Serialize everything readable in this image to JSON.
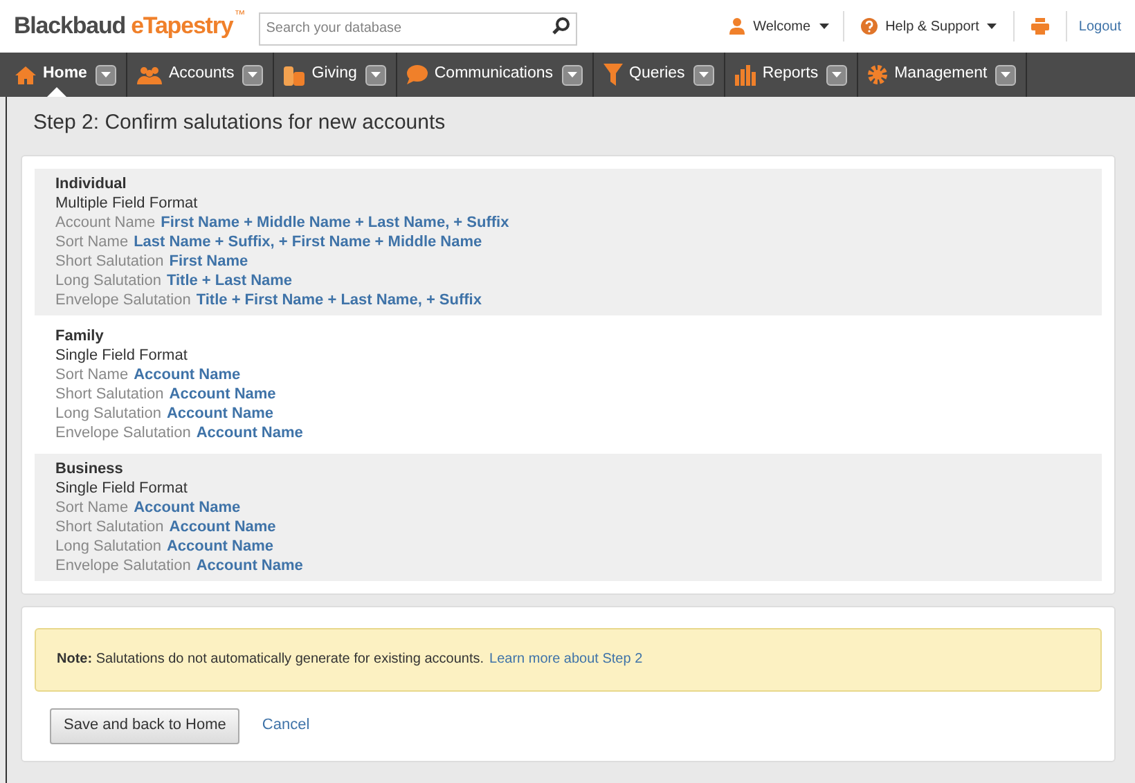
{
  "header": {
    "logo_main": "Blackbaud",
    "logo_accent": "eTapestry",
    "logo_mark": "™",
    "search": {
      "placeholder": "Search your database"
    },
    "welcome": "Welcome",
    "help": "Help & Support",
    "logout": "Logout"
  },
  "nav": [
    {
      "label": "Home",
      "selected": true
    },
    {
      "label": "Accounts",
      "selected": false
    },
    {
      "label": "Giving",
      "selected": false
    },
    {
      "label": "Communications",
      "selected": false
    },
    {
      "label": "Queries",
      "selected": false
    },
    {
      "label": "Reports",
      "selected": false
    },
    {
      "label": "Management",
      "selected": false
    }
  ],
  "page_title": "Step 2: Confirm salutations for new accounts",
  "sections": [
    {
      "title": "Individual",
      "format": "Multiple Field Format",
      "fields": [
        {
          "label": "Account Name",
          "value": "First Name + Middle Name + Last Name, + Suffix"
        },
        {
          "label": "Sort Name",
          "value": "Last Name + Suffix, + First Name + Middle Name"
        },
        {
          "label": "Short Salutation",
          "value": "First Name"
        },
        {
          "label": "Long Salutation",
          "value": "Title + Last Name"
        },
        {
          "label": "Envelope Salutation",
          "value": "Title + First Name + Last Name, + Suffix"
        }
      ]
    },
    {
      "title": "Family",
      "format": "Single Field Format",
      "fields": [
        {
          "label": "Sort Name",
          "value": "Account Name"
        },
        {
          "label": "Short Salutation",
          "value": "Account Name"
        },
        {
          "label": "Long Salutation",
          "value": "Account Name"
        },
        {
          "label": "Envelope Salutation",
          "value": "Account Name"
        }
      ]
    },
    {
      "title": "Business",
      "format": "Single Field Format",
      "fields": [
        {
          "label": "Sort Name",
          "value": "Account Name"
        },
        {
          "label": "Short Salutation",
          "value": "Account Name"
        },
        {
          "label": "Long Salutation",
          "value": "Account Name"
        },
        {
          "label": "Envelope Salutation",
          "value": "Account Name"
        }
      ]
    }
  ],
  "note": {
    "text": "**Note:** Salutations do not automatically generate for existing accounts.",
    "link": "Learn more about Step 2"
  },
  "buttons": {
    "save": "Save and back to Home",
    "cancel": "Cancel"
  }
}
